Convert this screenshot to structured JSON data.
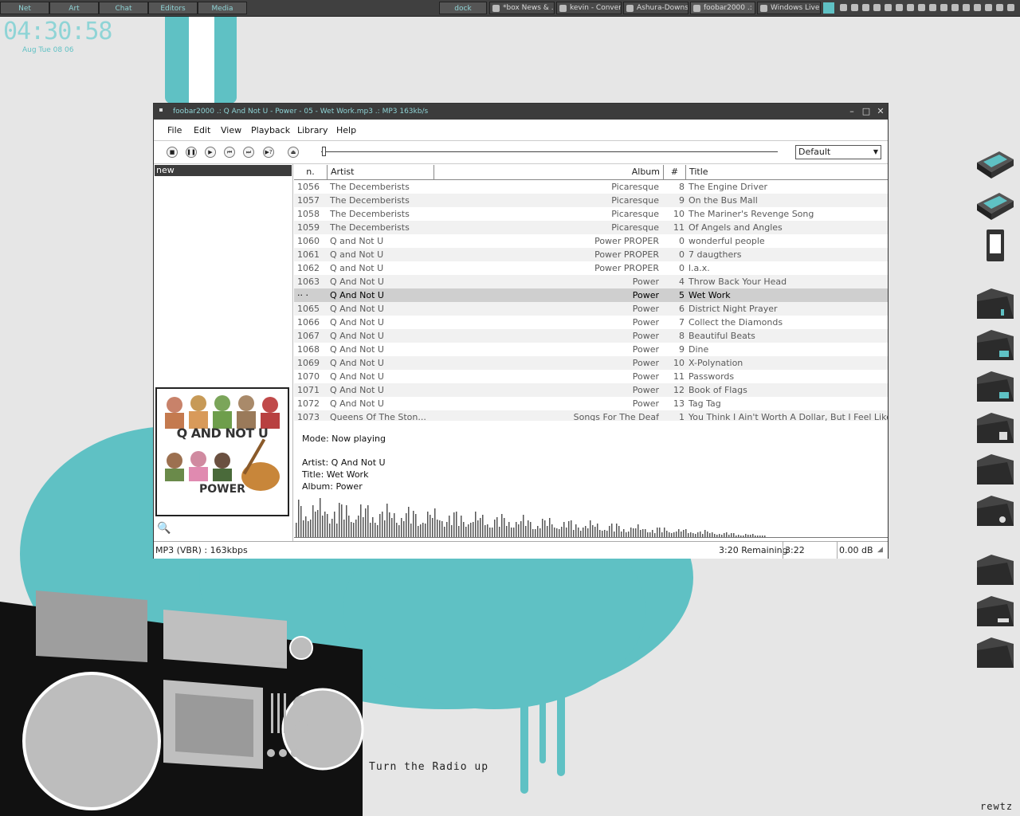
{
  "taskbar": {
    "groups": [
      "Net",
      "Art",
      "Chat",
      "Editors",
      "Media"
    ],
    "dock_label": "dock",
    "tasks": [
      "*box News & ...",
      "kevin - Conver...",
      "Ashura-Downs...",
      "foobar2000 .: ...",
      "Windows Live ..."
    ]
  },
  "clock": {
    "time": "04:30:58",
    "date": "Aug Tue 08 06"
  },
  "wallpaper": {
    "caption": "Turn the Radio up",
    "signature": "rewtz",
    "colors": {
      "accent": "#5fc1c4",
      "background": "#e6e6e6"
    }
  },
  "player": {
    "title": "foobar2000 .: Q And Not U - Power - 05 - Wet Work.mp3 .: MP3 163kb/s",
    "menu": [
      "File",
      "Edit",
      "View",
      "Playback",
      "Library",
      "Help"
    ],
    "toolbar": {
      "icons": [
        "stop-icon",
        "pause-icon",
        "play-icon",
        "previous-icon",
        "next-icon",
        "random-icon",
        "eject-icon"
      ],
      "dsp_preset": "Default"
    },
    "playlists": [
      "new"
    ],
    "columns": {
      "n": "n.",
      "artist": "Artist",
      "album": "Album",
      "num": "#",
      "title": "Title"
    },
    "rows": [
      {
        "n": "1056",
        "artist": "The Decemberists",
        "album": "Picaresque",
        "num": "8",
        "title": "The Engine Driver"
      },
      {
        "n": "1057",
        "artist": "The Decemberists",
        "album": "Picaresque",
        "num": "9",
        "title": "On the Bus Mall"
      },
      {
        "n": "1058",
        "artist": "The Decemberists",
        "album": "Picaresque",
        "num": "10",
        "title": "The Mariner's Revenge Song"
      },
      {
        "n": "1059",
        "artist": "The Decemberists",
        "album": "Picaresque",
        "num": "11",
        "title": "Of Angels and Angles"
      },
      {
        "n": "1060",
        "artist": "Q and Not U",
        "album": "Power PROPER",
        "num": "0",
        "title": "wonderful people"
      },
      {
        "n": "1061",
        "artist": "Q and Not U",
        "album": "Power PROPER",
        "num": "0",
        "title": "7 daugthers"
      },
      {
        "n": "1062",
        "artist": "Q and Not U",
        "album": "Power PROPER",
        "num": "0",
        "title": "l.a.x."
      },
      {
        "n": "1063",
        "artist": "Q And Not U",
        "album": "Power",
        "num": "4",
        "title": "Throw Back Your Head"
      },
      {
        "n": "·· ·",
        "artist": "Q And Not U",
        "album": "Power",
        "num": "5",
        "title": "Wet Work",
        "selected": true
      },
      {
        "n": "1065",
        "artist": "Q And Not U",
        "album": "Power",
        "num": "6",
        "title": "District Night Prayer"
      },
      {
        "n": "1066",
        "artist": "Q And Not U",
        "album": "Power",
        "num": "7",
        "title": "Collect the Diamonds"
      },
      {
        "n": "1067",
        "artist": "Q And Not U",
        "album": "Power",
        "num": "8",
        "title": "Beautiful Beats"
      },
      {
        "n": "1068",
        "artist": "Q And Not U",
        "album": "Power",
        "num": "9",
        "title": "Dine"
      },
      {
        "n": "1069",
        "artist": "Q And Not U",
        "album": "Power",
        "num": "10",
        "title": "X-Polynation"
      },
      {
        "n": "1070",
        "artist": "Q And Not U",
        "album": "Power",
        "num": "11",
        "title": "Passwords"
      },
      {
        "n": "1071",
        "artist": "Q And Not U",
        "album": "Power",
        "num": "12",
        "title": "Book of Flags"
      },
      {
        "n": "1072",
        "artist": "Q And Not U",
        "album": "Power",
        "num": "13",
        "title": "Tag Tag"
      },
      {
        "n": "1073",
        "artist": "Queens Of The Ston...",
        "album": "Songs For The Deaf",
        "num": "1",
        "title": "You Think I Ain't Worth A Dollar, But I Feel Like"
      }
    ],
    "album_art": {
      "line1": "Q AND NOT U",
      "line2": "POWER"
    },
    "info": {
      "mode": "Mode: Now playing",
      "artist": "Artist: Q And Not U",
      "title": "Title: Wet Work",
      "album": "Album: Power"
    },
    "status": {
      "format": "MP3 (VBR) : 163kbps",
      "remaining": "3:20 Remaining",
      "elapsed": "3:22",
      "gain": "0.00 dB"
    }
  }
}
